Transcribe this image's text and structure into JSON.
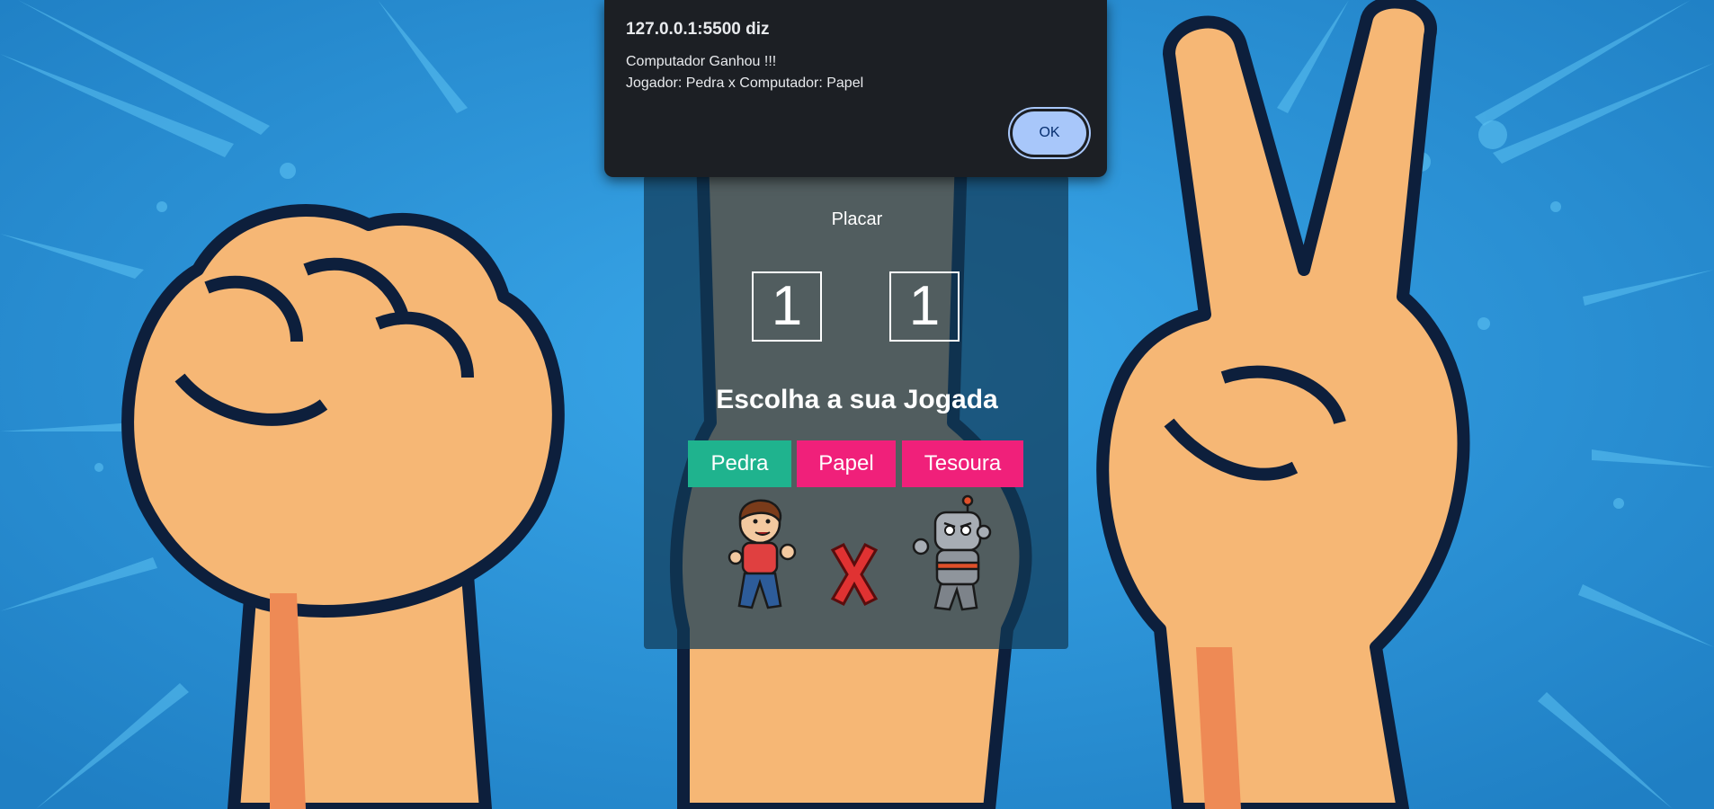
{
  "dialog": {
    "title": "127.0.0.1:5500 diz",
    "line1": "Computador Ganhou !!!",
    "line2": "Jogador: Pedra x Computador: Papel",
    "ok_label": "OK"
  },
  "game": {
    "score_label": "Placar",
    "player_score": "1",
    "computer_score": "1",
    "prompt": "Escolha a sua Jogada",
    "buttons": {
      "pedra": "Pedra",
      "papel": "Papel",
      "tesoura": "Tesoura"
    }
  },
  "colors": {
    "pedra": "#1fb38e",
    "papel": "#f0207a",
    "tesoura": "#f0207a"
  }
}
